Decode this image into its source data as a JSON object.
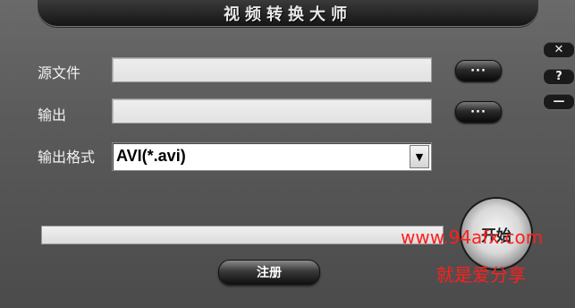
{
  "window": {
    "title": "视频转换大师"
  },
  "controls": {
    "close_glyph": "✕",
    "help_glyph": "?",
    "minimize_glyph": "—"
  },
  "form": {
    "source_label": "源文件",
    "source_value": "",
    "output_label": "输出",
    "output_value": "",
    "browse_label": "···",
    "format_label": "输出格式",
    "format_selected": "AVI(*.avi)"
  },
  "progress": {
    "value": 0
  },
  "actions": {
    "start_label": "开始",
    "register_label": "注册"
  },
  "watermark": {
    "line1": "www.94afx.com",
    "line2": "就是爱分享",
    "color": "#ff1f1f"
  }
}
